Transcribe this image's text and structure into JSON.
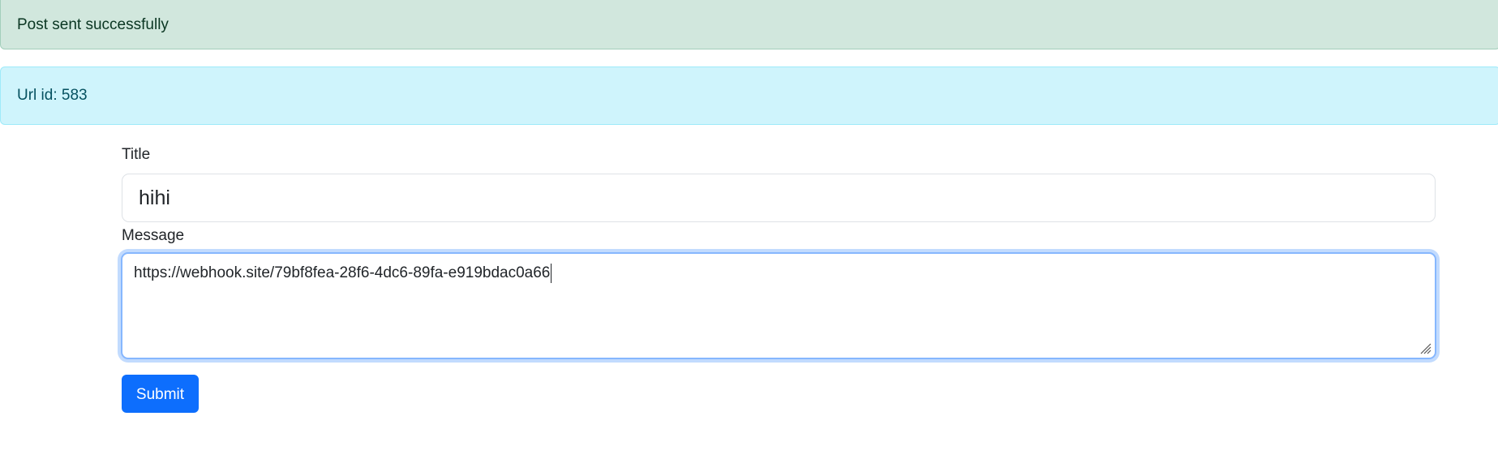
{
  "alerts": {
    "success_text": "Post sent successfully",
    "info_text": "Url id: 583"
  },
  "form": {
    "title_label": "Title",
    "title_value": "hihi",
    "message_label": "Message",
    "message_value": "https://webhook.site/79bf8fea-28f6-4dc6-89fa-e919bdac0a66",
    "submit_label": "Submit"
  },
  "colors": {
    "success_bg": "#d1e7dd",
    "info_bg": "#cff4fc",
    "primary": "#0d6efd",
    "focus_border": "#86b7fe"
  },
  "icons": {
    "resize": "textarea-resize-handle-icon"
  }
}
